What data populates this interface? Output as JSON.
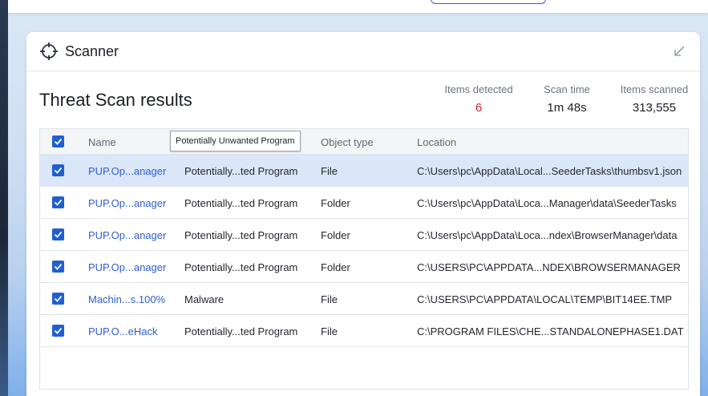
{
  "panel": {
    "title": "Scanner"
  },
  "results": {
    "title": "Threat Scan results",
    "stats": [
      {
        "label": "Items detected",
        "value": "6"
      },
      {
        "label": "Scan time",
        "value": "1m 48s"
      },
      {
        "label": "Items scanned",
        "value": "313,555"
      }
    ]
  },
  "table": {
    "columns": {
      "name": "Name",
      "type": "Potentially Unwanted Program",
      "object": "Object type",
      "location": "Location"
    },
    "rows": [
      {
        "name": "PUP.Op...anager",
        "category": "Potentially...ted Program",
        "object": "File",
        "location": "C:\\Users\\pc\\AppData\\Local...SeederTasks\\thumbsv1.json"
      },
      {
        "name": "PUP.Op...anager",
        "category": "Potentially...ted Program",
        "object": "Folder",
        "location": "C:\\Users\\pc\\AppData\\Loca...Manager\\data\\SeederTasks"
      },
      {
        "name": "PUP.Op...anager",
        "category": "Potentially...ted Program",
        "object": "Folder",
        "location": "C:\\Users\\pc\\AppData\\Loca...ndex\\BrowserManager\\data"
      },
      {
        "name": "PUP.Op...anager",
        "category": "Potentially...ted Program",
        "object": "Folder",
        "location": "C:\\USERS\\PC\\APPDATA...NDEX\\BROWSERMANAGER"
      },
      {
        "name": "Machin...s.100%",
        "category": "Malware",
        "object": "File",
        "location": "C:\\USERS\\PC\\APPDATA\\LOCAL\\TEMP\\BIT14EE.TMP"
      },
      {
        "name": "PUP.O...eHack",
        "category": "Potentially...ted Program",
        "object": "File",
        "location": "C:\\PROGRAM FILES\\CHE...STANDALONEPHASE1.DAT"
      }
    ]
  },
  "colors": {
    "accent": "#1f5fd3",
    "link": "#2f5fd0",
    "detected": "#d12a2a",
    "selected_row": "#dbe7f8"
  }
}
